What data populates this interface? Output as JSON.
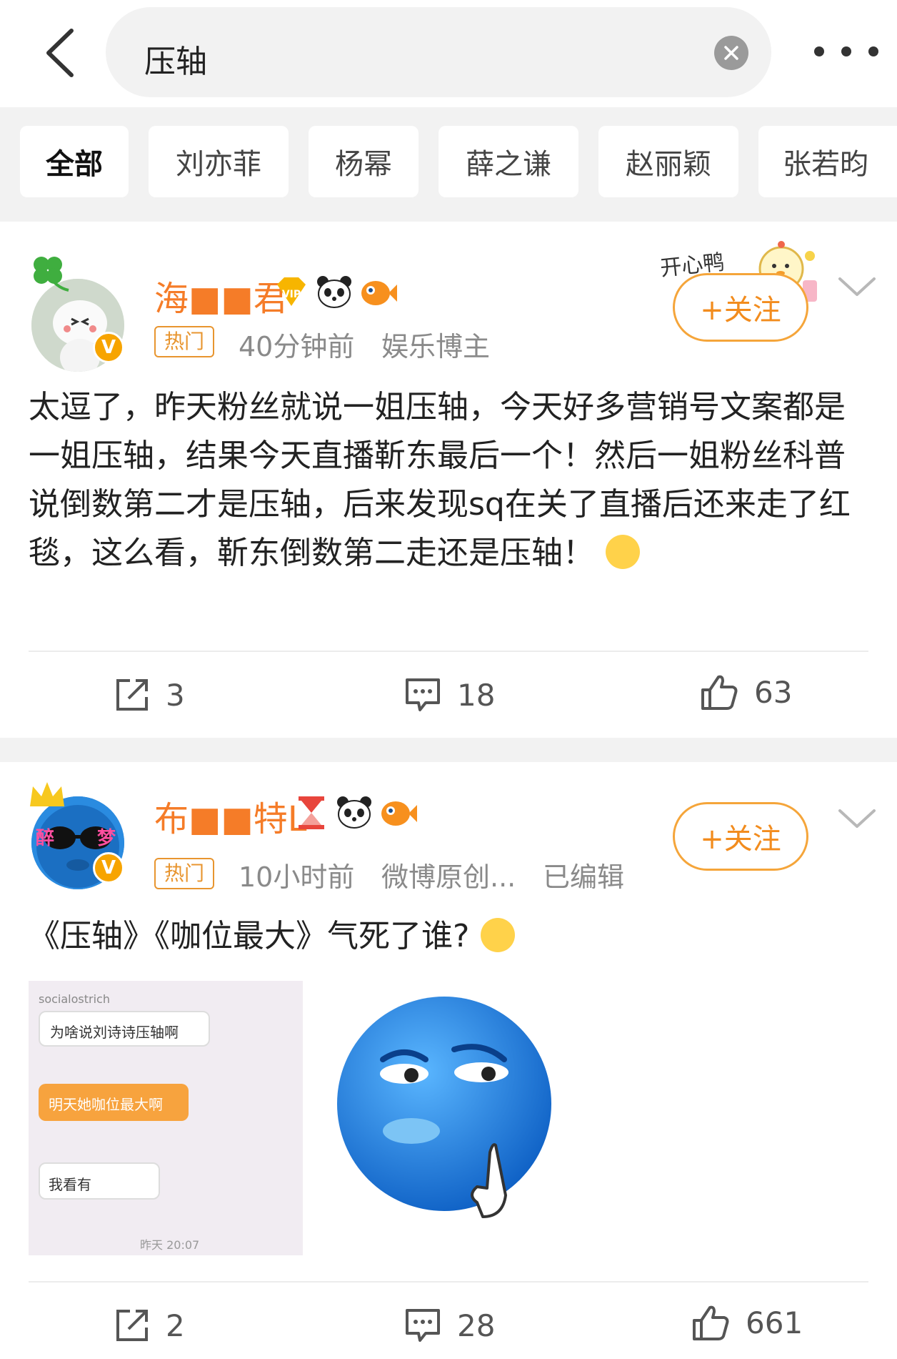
{
  "search": {
    "query": "压轴"
  },
  "tabs": [
    {
      "label": "全部"
    },
    {
      "label": "刘亦菲"
    },
    {
      "label": "杨幂"
    },
    {
      "label": "薛之谦"
    },
    {
      "label": "赵丽颖"
    },
    {
      "label": "张若昀"
    }
  ],
  "posts": [
    {
      "username": "海■■君",
      "hot_tag": "热门",
      "time": "40分钟前",
      "source": "娱乐博主",
      "follow_label": "+关注",
      "sticker_text": "开心鸭",
      "text": "太逗了，昨天粉丝就说一姐压轴，今天好多营销号文案都是一姐压轴，结果今天直播靳东最后一个！然后一姐粉丝科普说倒数第二才是压轴，后来发现sq在关了直播后还来走了红毯，这么看，靳东倒数第二走还是压轴！",
      "repost_count": "3",
      "comment_count": "18",
      "like_count": "63"
    },
    {
      "username": "布■■特L",
      "hot_tag": "热门",
      "time": "10小时前",
      "source": "微博原创...",
      "edited": "已编辑",
      "follow_label": "+关注",
      "avatar_text_left": "醉",
      "avatar_text_right": "梦",
      "text": "《压轴》《咖位最大》气死了谁?",
      "image1": {
        "header": "socialostrich",
        "msg1": "为啥说刘诗诗压轴啊",
        "msg2": "明天她咖位最大啊",
        "msg3": "我看有",
        "time": "昨天 20:07"
      },
      "repost_count": "2",
      "comment_count": "28",
      "like_count": "661"
    }
  ]
}
